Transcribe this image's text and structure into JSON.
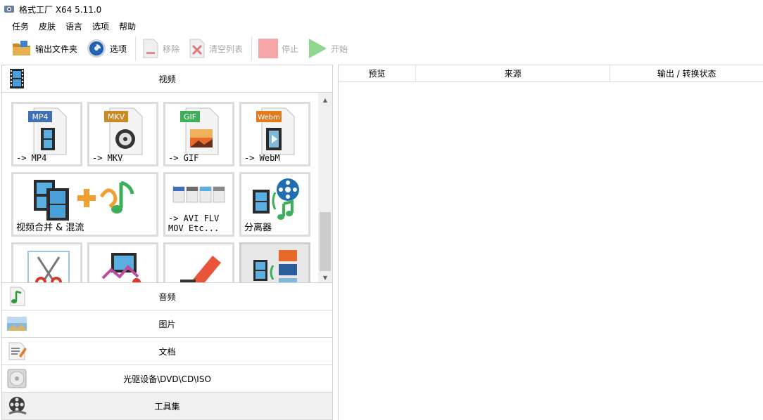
{
  "window": {
    "title": "格式工厂 X64 5.11.0"
  },
  "menu": [
    "任务",
    "皮肤",
    "语言",
    "选项",
    "帮助"
  ],
  "toolbar": {
    "output_folder": "输出文件夹",
    "options": "选项",
    "remove": "移除",
    "clear_list": "清空列表",
    "stop": "停止",
    "start": "开始"
  },
  "categories": {
    "video": "视频",
    "audio": "音频",
    "image": "图片",
    "document": "文档",
    "disc": "光驱设备\\DVD\\CD\\ISO",
    "tools": "工具集"
  },
  "video_tiles": {
    "mp4": {
      "badge": "MP4",
      "label": "-> MP4"
    },
    "mkv": {
      "badge": "MKV",
      "label": "-> MKV"
    },
    "gif": {
      "badge": "GIF",
      "label": "-> GIF"
    },
    "webm": {
      "badge": "Webm",
      "label": "-> WebM"
    },
    "merge": {
      "label": "视频合并 & 混流"
    },
    "avi": {
      "label_line1": "-> AVI FLV",
      "label_line2": "MOV Etc..."
    },
    "splitter": {
      "label": "分离器"
    }
  },
  "task_list": {
    "columns": [
      "预览",
      "来源",
      "输出 / 转换状态"
    ]
  },
  "colors": {
    "mp4_badge": "#3f6fb5",
    "mkv_badge": "#c88a25",
    "gif_badge": "#3fae5a",
    "webm_badge": "#e07b1f",
    "stop_icon": "#f4a6a6",
    "start_icon": "#8fd68f"
  }
}
